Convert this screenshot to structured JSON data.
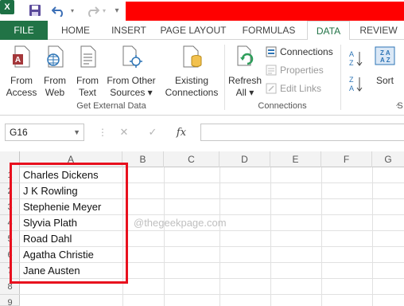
{
  "qat": {
    "logo_text": "X",
    "icons": [
      "excel-logo-icon",
      "save-icon",
      "undo-icon",
      "redo-icon",
      "customize-icon"
    ]
  },
  "tabs": [
    {
      "label": "FILE"
    },
    {
      "label": "HOME"
    },
    {
      "label": "INSERT"
    },
    {
      "label": "PAGE LAYOUT"
    },
    {
      "label": "FORMULAS"
    },
    {
      "label": "DATA"
    },
    {
      "label": "REVIEW"
    }
  ],
  "ribbon": {
    "get_external": {
      "buttons": [
        {
          "line1": "From",
          "line2": "Access"
        },
        {
          "line1": "From",
          "line2": "Web"
        },
        {
          "line1": "From",
          "line2": "Text"
        },
        {
          "line1": "From Other",
          "line2": "Sources ▾"
        },
        {
          "line1": "Existing",
          "line2": "Connections"
        }
      ],
      "label": "Get External Data"
    },
    "connections": {
      "refresh_line1": "Refresh",
      "refresh_line2": "All ▾",
      "items": [
        "Connections",
        "Properties",
        "Edit Links"
      ],
      "label": "Connections"
    },
    "sort": {
      "label": "Sort"
    }
  },
  "formula_bar": {
    "name_box": "G16",
    "fx": "fx",
    "cancel": "✕",
    "enter": "✓",
    "value": ""
  },
  "grid": {
    "columns": [
      "A",
      "B",
      "C",
      "D",
      "E",
      "F",
      "G"
    ],
    "rows": [
      "1",
      "2",
      "3",
      "4",
      "5",
      "6",
      "7",
      "8",
      "9"
    ],
    "cells_a": [
      "Charles Dickens",
      "J K Rowling",
      "Stephenie Meyer",
      "Slyvia Plath",
      "Road Dahl",
      "Agatha Christie",
      "Jane Austen"
    ]
  },
  "watermark": "@thegeekpage.com",
  "colors": {
    "accent": "#217346",
    "highlight": "#e8101e"
  }
}
